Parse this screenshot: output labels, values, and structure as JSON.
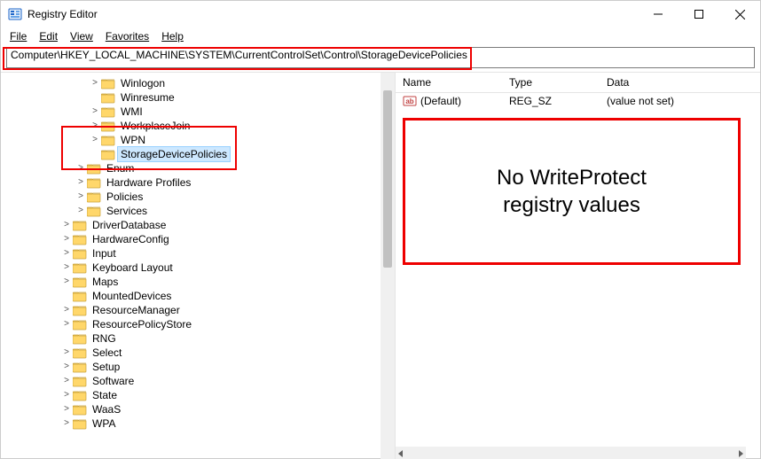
{
  "window": {
    "title": "Registry Editor"
  },
  "menus": [
    "File",
    "Edit",
    "View",
    "Favorites",
    "Help"
  ],
  "address": "Computer\\HKEY_LOCAL_MACHINE\\SYSTEM\\CurrentControlSet\\Control\\StorageDevicePolicies",
  "columns": {
    "name": "Name",
    "type": "Type",
    "data": "Data"
  },
  "values": [
    {
      "name": "(Default)",
      "type": "REG_SZ",
      "data": "(value not set)"
    }
  ],
  "callout": "No WriteProtect\nregistry values",
  "tree": [
    {
      "indent": 96,
      "chev": ">",
      "label": "Winlogon"
    },
    {
      "indent": 96,
      "chev": "",
      "label": "Winresume"
    },
    {
      "indent": 96,
      "chev": ">",
      "label": "WMI"
    },
    {
      "indent": 96,
      "chev": ">",
      "label": "WorkplaceJoin"
    },
    {
      "indent": 96,
      "chev": ">",
      "label": "WPN"
    },
    {
      "indent": 96,
      "chev": "",
      "label": "StorageDevicePolicies",
      "selected": true
    },
    {
      "indent": 80,
      "chev": ">",
      "label": "Enum"
    },
    {
      "indent": 80,
      "chev": ">",
      "label": "Hardware Profiles"
    },
    {
      "indent": 80,
      "chev": ">",
      "label": "Policies"
    },
    {
      "indent": 80,
      "chev": ">",
      "label": "Services"
    },
    {
      "indent": 64,
      "chev": ">",
      "label": "DriverDatabase"
    },
    {
      "indent": 64,
      "chev": ">",
      "label": "HardwareConfig"
    },
    {
      "indent": 64,
      "chev": ">",
      "label": "Input"
    },
    {
      "indent": 64,
      "chev": ">",
      "label": "Keyboard Layout"
    },
    {
      "indent": 64,
      "chev": ">",
      "label": "Maps"
    },
    {
      "indent": 64,
      "chev": "",
      "label": "MountedDevices"
    },
    {
      "indent": 64,
      "chev": ">",
      "label": "ResourceManager"
    },
    {
      "indent": 64,
      "chev": ">",
      "label": "ResourcePolicyStore"
    },
    {
      "indent": 64,
      "chev": "",
      "label": "RNG"
    },
    {
      "indent": 64,
      "chev": ">",
      "label": "Select"
    },
    {
      "indent": 64,
      "chev": ">",
      "label": "Setup"
    },
    {
      "indent": 64,
      "chev": ">",
      "label": "Software"
    },
    {
      "indent": 64,
      "chev": ">",
      "label": "State"
    },
    {
      "indent": 64,
      "chev": ">",
      "label": "WaaS"
    },
    {
      "indent": 64,
      "chev": ">",
      "label": "WPA"
    }
  ]
}
